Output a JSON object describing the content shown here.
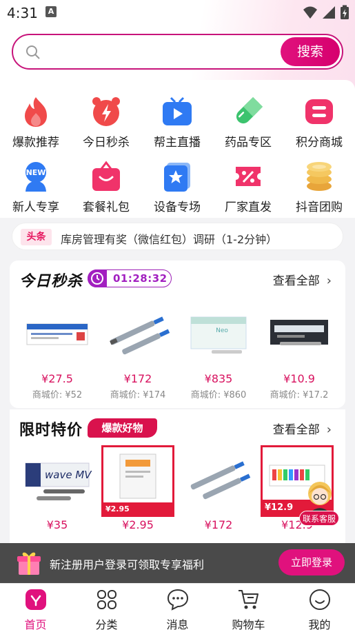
{
  "status_bar": {
    "time": "4:31",
    "indicator": "A"
  },
  "search": {
    "placeholder": "",
    "button_label": "搜索"
  },
  "categories": [
    {
      "label": "爆款推荐",
      "icon": "flame-icon"
    },
    {
      "label": "今日秒杀",
      "icon": "alarm-clock-icon"
    },
    {
      "label": "帮主直播",
      "icon": "live-tv-icon"
    },
    {
      "label": "药品专区",
      "icon": "pill-icon"
    },
    {
      "label": "积分商城",
      "icon": "points-icon"
    },
    {
      "label": "新人专享",
      "icon": "new-user-icon"
    },
    {
      "label": "套餐礼包",
      "icon": "gift-bag-icon"
    },
    {
      "label": "设备专场",
      "icon": "device-star-icon"
    },
    {
      "label": "厂家直发",
      "icon": "coupon-icon"
    },
    {
      "label": "抖音团购",
      "icon": "coins-icon"
    }
  ],
  "news": {
    "tag": "头条",
    "text": "库房管理有奖（微信红包）调研（1-2分钟）"
  },
  "flash_sale": {
    "title": "今日秒杀",
    "countdown": "01:28:32",
    "see_all": "查看全部",
    "products": [
      {
        "price": "¥27.5",
        "mall_price": "商城价: ¥52"
      },
      {
        "price": "¥172",
        "mall_price": "商城价: ¥174"
      },
      {
        "price": "¥835",
        "mall_price": "商城价: ¥860"
      },
      {
        "price": "¥10.9",
        "mall_price": "商城价: ¥17.2"
      }
    ]
  },
  "limited_offer": {
    "title": "限时特价",
    "tag": "爆款好物",
    "see_all": "查看全部",
    "products": [
      {
        "price": "¥35",
        "img_text": "wave MV"
      },
      {
        "price": "¥2.95",
        "img_price": "¥2.95"
      },
      {
        "price": "¥172"
      },
      {
        "price": "¥12.9",
        "img_price": "¥12.9"
      }
    ]
  },
  "customer_service": {
    "label": "联系客服"
  },
  "register_banner": {
    "text": "新注册用户登录可领取专享福利",
    "button_label": "立即登录"
  },
  "bottom_nav": [
    {
      "label": "首页",
      "icon": "home-icon",
      "active": true
    },
    {
      "label": "分类",
      "icon": "category-icon",
      "active": false
    },
    {
      "label": "消息",
      "icon": "message-icon",
      "active": false
    },
    {
      "label": "购物车",
      "icon": "cart-icon",
      "active": false
    },
    {
      "label": "我的",
      "icon": "profile-icon",
      "active": false
    }
  ],
  "colors": {
    "accent": "#e0117d",
    "price": "#d8125f",
    "timer": "#a21fc0"
  }
}
